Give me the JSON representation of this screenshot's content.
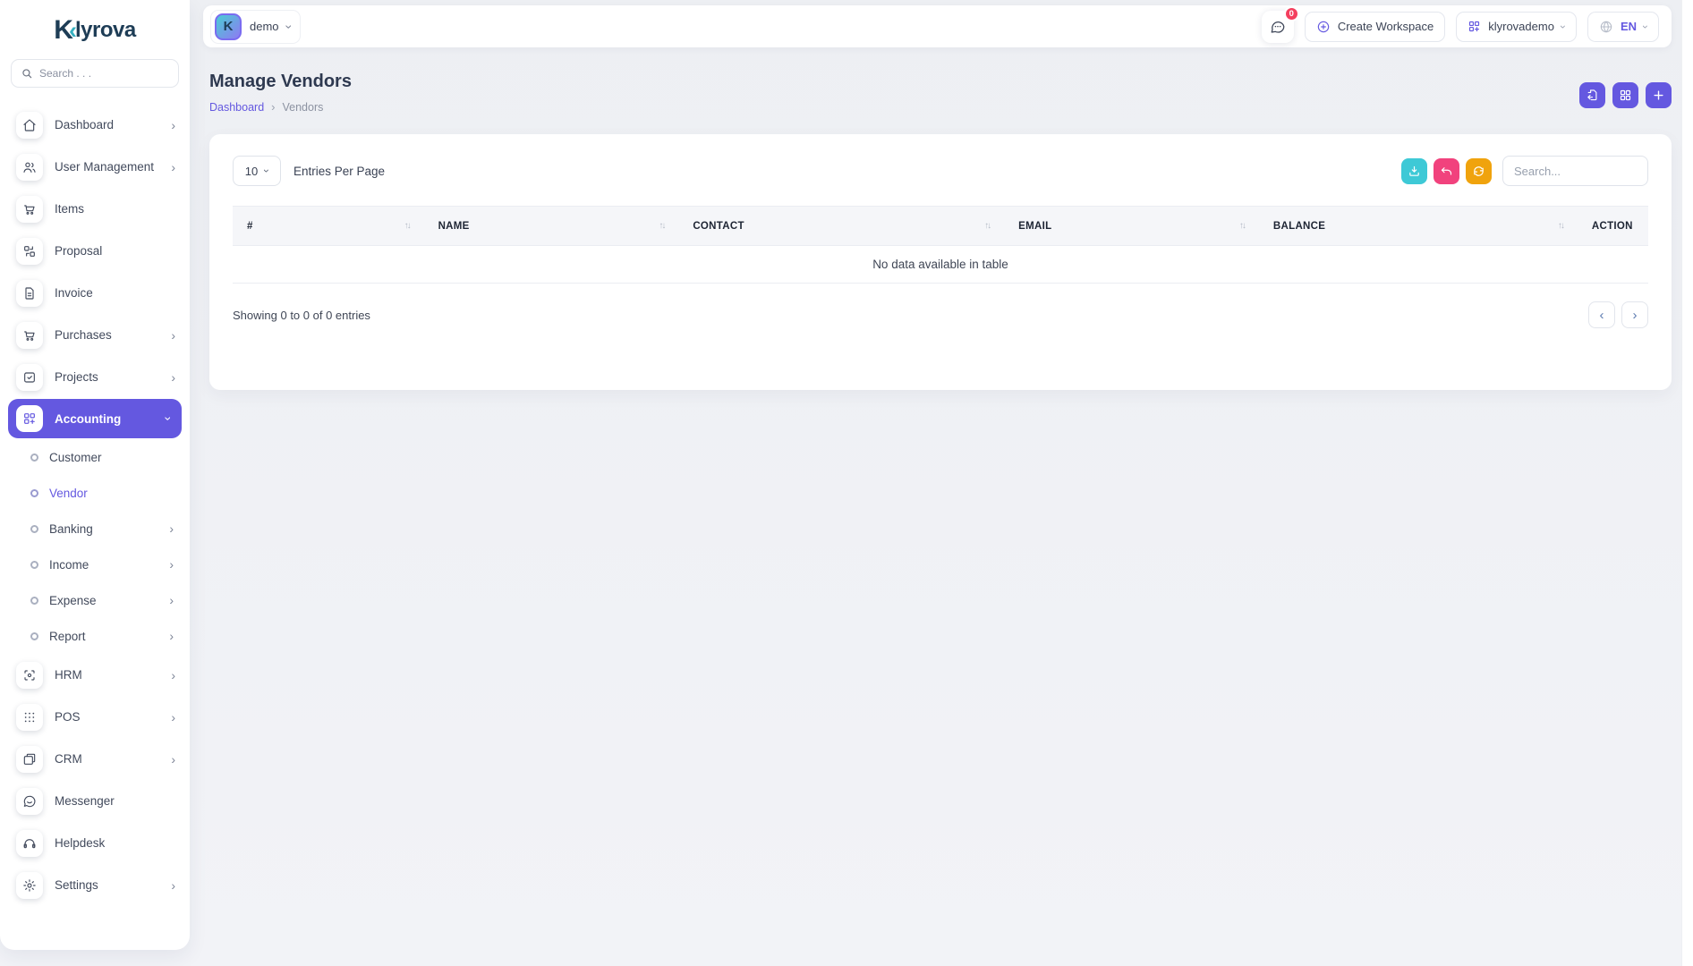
{
  "brand": {
    "logo_k": "K",
    "logo_chevron": "‹",
    "logo_rest": "lyrova",
    "name": "Klyrova"
  },
  "icons": {
    "chevron_right": "›",
    "sort": "↑↓",
    "breadcrumb_sep": "›",
    "page_prev": "‹",
    "page_next": "›"
  },
  "colors": {
    "primary": "#6458e0",
    "teal": "#3ec9d6",
    "pink": "#f1427d",
    "orange": "#f0a30d",
    "badge_red": "#f43f5e",
    "logo_navy": "#1e3d56",
    "logo_teal": "#35b0c0"
  },
  "sidebar": {
    "search_placeholder": "Search . . .",
    "main_items": [
      {
        "label": "Dashboard",
        "has_chevron": true
      },
      {
        "label": "User Management",
        "has_chevron": true
      },
      {
        "label": "Items",
        "has_chevron": false
      },
      {
        "label": "Proposal",
        "has_chevron": false
      },
      {
        "label": "Invoice",
        "has_chevron": false
      },
      {
        "label": "Purchases",
        "has_chevron": true
      },
      {
        "label": "Projects",
        "has_chevron": true
      },
      {
        "label": "Accounting",
        "has_chevron": true,
        "active": true,
        "expanded": true
      }
    ],
    "accounting_children": [
      {
        "label": "Customer",
        "has_chevron": false
      },
      {
        "label": "Vendor",
        "has_chevron": false,
        "active": true
      },
      {
        "label": "Banking",
        "has_chevron": true
      },
      {
        "label": "Income",
        "has_chevron": true
      },
      {
        "label": "Expense",
        "has_chevron": true
      },
      {
        "label": "Report",
        "has_chevron": true
      }
    ],
    "bottom_items": [
      {
        "label": "HRM",
        "has_chevron": true
      },
      {
        "label": "POS",
        "has_chevron": true
      },
      {
        "label": "CRM",
        "has_chevron": true
      },
      {
        "label": "Messenger",
        "has_chevron": false
      },
      {
        "label": "Helpdesk",
        "has_chevron": false
      },
      {
        "label": "Settings",
        "has_chevron": true
      }
    ]
  },
  "header": {
    "workspace_name": "demo",
    "workspace_avatar_letter": "K",
    "chat_badge_count": "0",
    "create_workspace_label": "Create Workspace",
    "active_workspace_label": "klyrovademo",
    "language_label": "EN"
  },
  "page": {
    "title": "Manage Vendors",
    "breadcrumb_home": "Dashboard",
    "breadcrumb_current": "Vendors"
  },
  "card": {
    "entries_per_page_value": "10",
    "entries_per_page_label": "Entries Per Page",
    "search_placeholder": "Search..."
  },
  "table": {
    "columns": [
      "#",
      "NAME",
      "CONTACT",
      "EMAIL",
      "BALANCE",
      "ACTION"
    ],
    "empty_message": "No data available in table",
    "footer_text": "Showing 0 to 0 of 0 entries"
  }
}
